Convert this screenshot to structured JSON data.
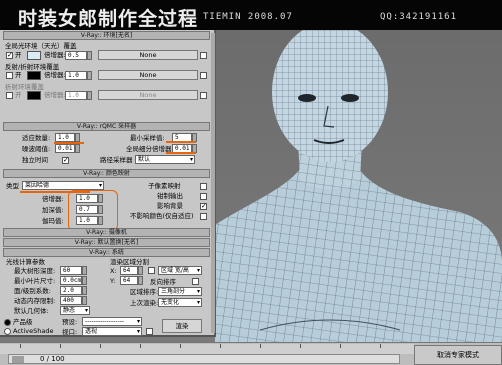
{
  "banner": {
    "title": "时装女郎制作全过程",
    "credit": "TIEMIN 2008.07",
    "qq": "QQ:342191161"
  },
  "panel": {
    "env": {
      "header": "V-Ray:: 环境[无名]",
      "gi_group": "全局光环境（天光）覆盖",
      "gi_on_label": "开",
      "gi_mult_label": "倍增器:",
      "gi_mult": "0.5",
      "gi_map": "None",
      "refl_group": "反射/折射环境覆盖",
      "refl_on_label": "开",
      "refl_mult_label": "倍增器:",
      "refl_mult": "1.0",
      "refl_map": "None",
      "refr_group": "折射环境覆盖",
      "refr_on_label": "开",
      "refr_mult_label": "倍增器:",
      "refr_mult": "1.0",
      "refr_map": "None"
    },
    "qmc": {
      "header": "V-Ray:: rQMC 采样器",
      "adaptive_label": "适应数量:",
      "adaptive": "1.0",
      "noise_label": "噪波阈值:",
      "noise": "0.01",
      "indep_label": "独立时间",
      "min_samples_label": "最小采样值:",
      "min_samples": "5",
      "global_sub_label": "全局细分倍增器:",
      "global_sub": "0.01",
      "path_label": "路径采样器",
      "path_value": "默认"
    },
    "color": {
      "header": "V-Ray:: 颜色映射",
      "type_label": "类型",
      "type_value": "莱因哈德",
      "sub_pixel": "子像素映射",
      "clamp_output": "钳制输出",
      "affect_bg": "影响背景",
      "no_affect": "不影响颜色(仅自适应)",
      "mult_label": "倍增器:",
      "mult": "1.0",
      "burn_label": "加深值:",
      "burn": "0.7",
      "gamma_label": "伽玛值:",
      "gamma": "1.0"
    },
    "camera_header": "V-Ray:: 摄像机",
    "displace_header": "V-Ray:: 默认置换[无名]",
    "system": {
      "header": "V-Ray:: 系统",
      "raycast_group": "光线计算参数",
      "max_tree_label": "最大树形深度:",
      "max_tree": "60",
      "min_leaf_label": "最小叶片尺寸:",
      "min_leaf": "0.0cm",
      "face_label": "面/级别系数:",
      "face": "2.0",
      "dyn_mem_label": "动态内存限制:",
      "dyn_mem": "400",
      "default_geo_label": "默认几何体:",
      "default_geo": "静态",
      "region_group": "渲染区域分割",
      "x_label": "X:",
      "x": "64",
      "y_label": "Y:",
      "y": "64",
      "region_mode": "区域 宽/高",
      "reverse": "反向排序",
      "region_sort_label": "区域排序:",
      "region_sort": "三角剖分",
      "last_render_label": "上次渲染:",
      "last_render": "无变化"
    },
    "footer": {
      "product": "产品级",
      "activeshade": "ActiveShade",
      "preset_label": "预设:",
      "preset": "------------------",
      "view_label": "视口:",
      "view": "透视",
      "render_btn": "渲染"
    }
  },
  "timeline": {
    "frame_label": "0 / 100",
    "expert_btn": "取消专家模式"
  }
}
